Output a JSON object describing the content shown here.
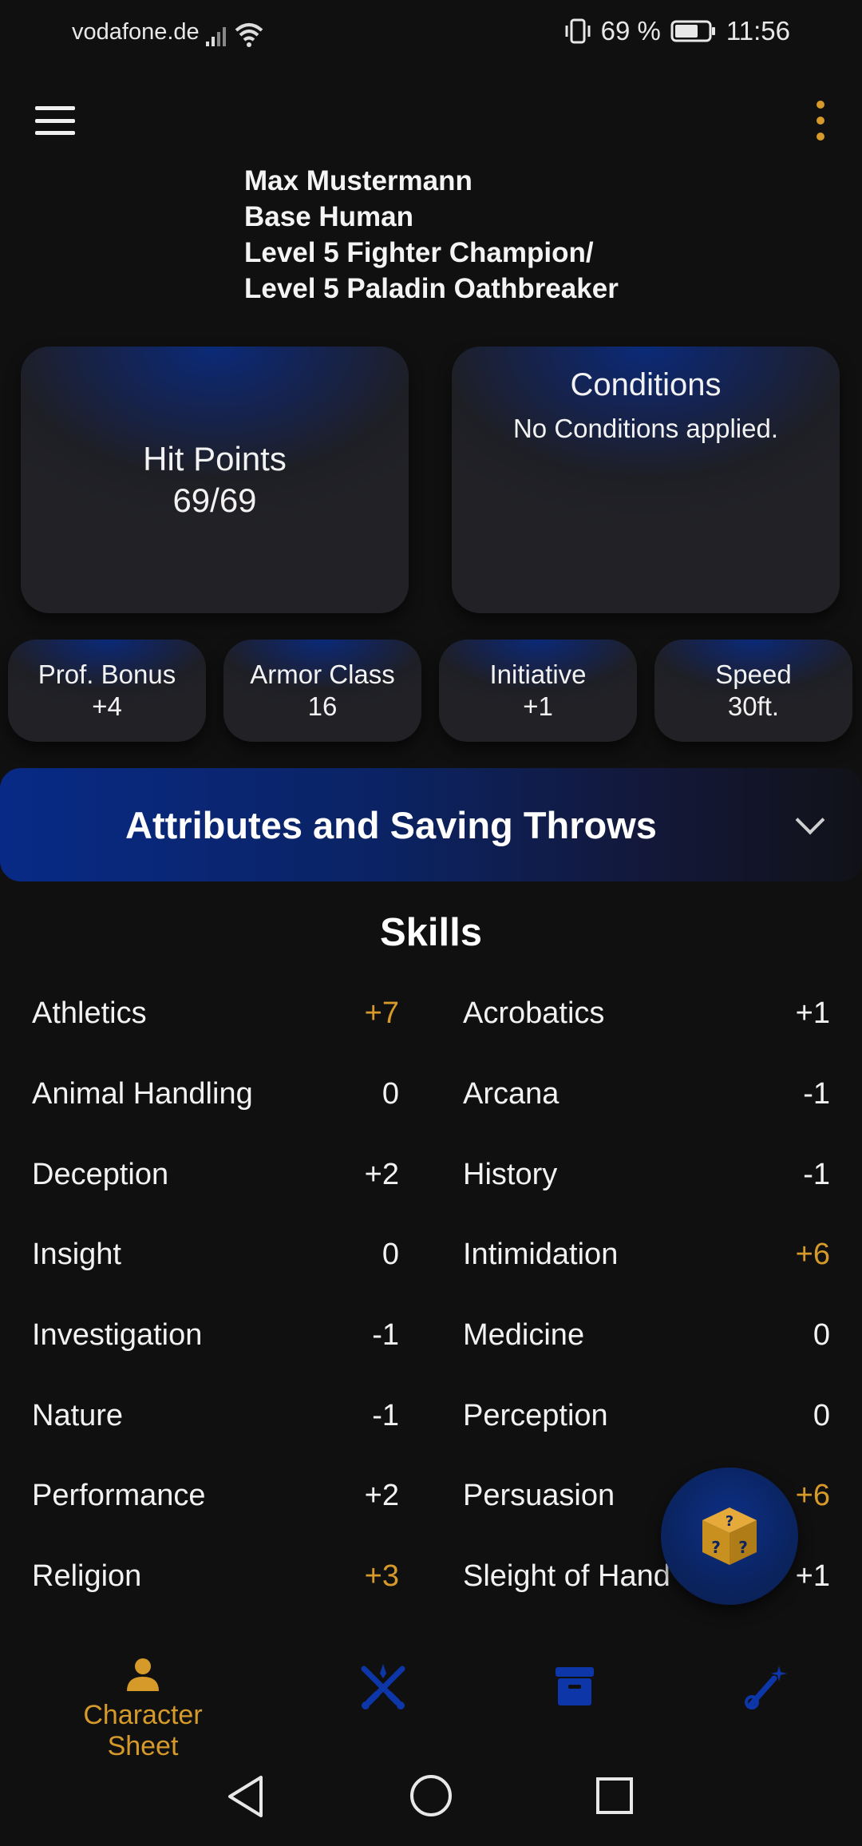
{
  "status_bar": {
    "carrier": "vodafone.de",
    "battery_text": "69 %",
    "time": "11:56"
  },
  "character": {
    "name": "Max Mustermann",
    "race": "Base Human",
    "class_line1": "Level 5 Fighter Champion/",
    "class_line2": "Level 5 Paladin Oathbreaker"
  },
  "hit_points": {
    "label": "Hit Points",
    "value": "69/69"
  },
  "conditions": {
    "title": "Conditions",
    "text": "No Conditions applied."
  },
  "stats": [
    {
      "label": "Prof. Bonus",
      "value": "+4"
    },
    {
      "label": "Armor Class",
      "value": "16"
    },
    {
      "label": "Initiative",
      "value": "+1"
    },
    {
      "label": "Speed",
      "value": "30ft."
    }
  ],
  "attributes": {
    "title": "Attributes and Saving Throws"
  },
  "skills": {
    "title": "Skills",
    "left": [
      {
        "name": "Athletics",
        "value": "+7",
        "proficient": true
      },
      {
        "name": "Animal Handling",
        "value": "0",
        "proficient": false
      },
      {
        "name": "Deception",
        "value": "+2",
        "proficient": false
      },
      {
        "name": "Insight",
        "value": "0",
        "proficient": false
      },
      {
        "name": "Investigation",
        "value": "-1",
        "proficient": false
      },
      {
        "name": "Nature",
        "value": "-1",
        "proficient": false
      },
      {
        "name": "Performance",
        "value": "+2",
        "proficient": false
      },
      {
        "name": "Religion",
        "value": "+3",
        "proficient": true
      }
    ],
    "right": [
      {
        "name": "Acrobatics",
        "value": "+1",
        "proficient": false
      },
      {
        "name": "Arcana",
        "value": "-1",
        "proficient": false
      },
      {
        "name": "History",
        "value": "-1",
        "proficient": false
      },
      {
        "name": "Intimidation",
        "value": "+6",
        "proficient": true
      },
      {
        "name": "Medicine",
        "value": "0",
        "proficient": false
      },
      {
        "name": "Perception",
        "value": "0",
        "proficient": false
      },
      {
        "name": "Persuasion",
        "value": "+6",
        "proficient": true
      },
      {
        "name": "Sleight of Hand",
        "value": "+1",
        "proficient": false
      }
    ]
  },
  "bottom_nav": {
    "items": [
      {
        "label": "Character Sheet",
        "icon": "person-icon",
        "active": true
      },
      {
        "label": "",
        "icon": "crossed-swords-icon",
        "active": false
      },
      {
        "label": "",
        "icon": "archive-box-icon",
        "active": false
      },
      {
        "label": "",
        "icon": "magic-wand-icon",
        "active": false
      }
    ]
  },
  "colors": {
    "accent": "#d69a2a",
    "primary_blue": "#0b2a80",
    "background": "#101010"
  }
}
